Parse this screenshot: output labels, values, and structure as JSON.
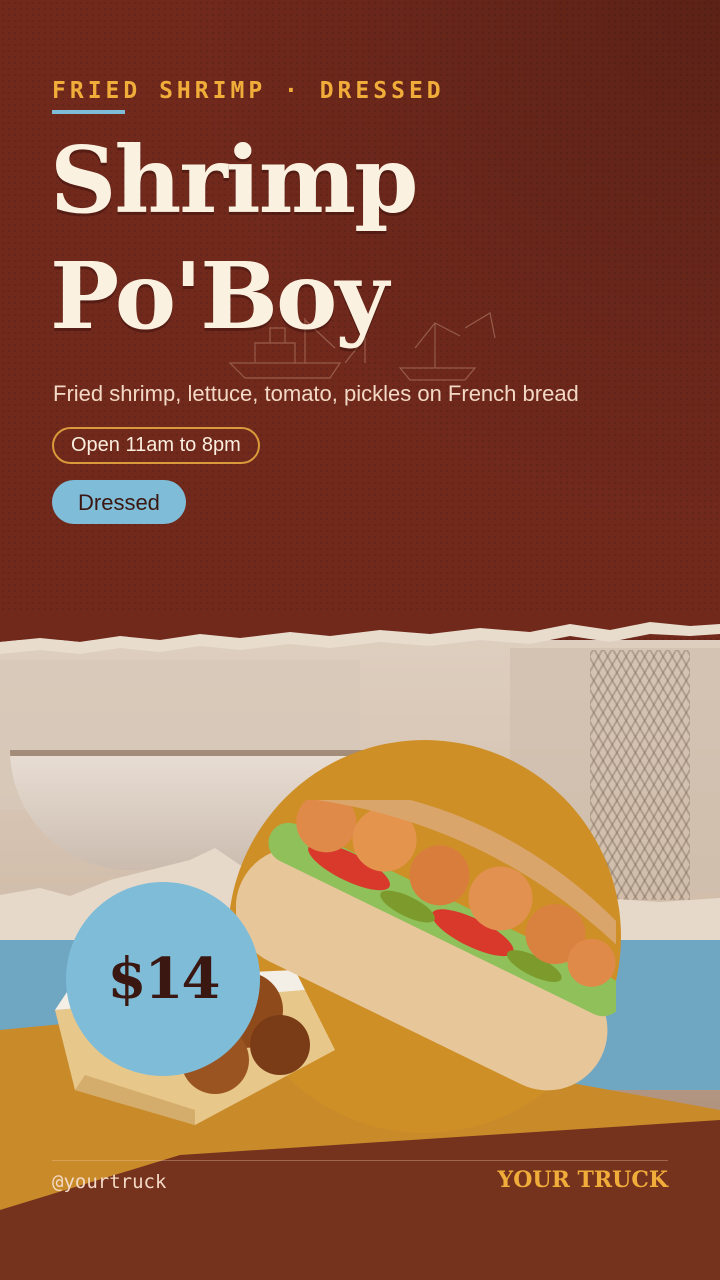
{
  "header": {
    "kicker": "FRIED SHRIMP · DRESSED",
    "title_line1": "Shrimp",
    "title_line2": "Po'Boy",
    "subtitle": "Fried shrimp, lettuce, tomato, pickles on French bread",
    "hours": "Open 11am to 8pm",
    "style_tag": "Dressed"
  },
  "price": "$14",
  "footer": {
    "handle": "@yourtruck",
    "brand": "YOUR TRUCK"
  },
  "colors": {
    "maroon": "#71291c",
    "gold": "#f0ad3a",
    "sky_blue": "#7fbcd8",
    "cream": "#fbf1e0"
  }
}
